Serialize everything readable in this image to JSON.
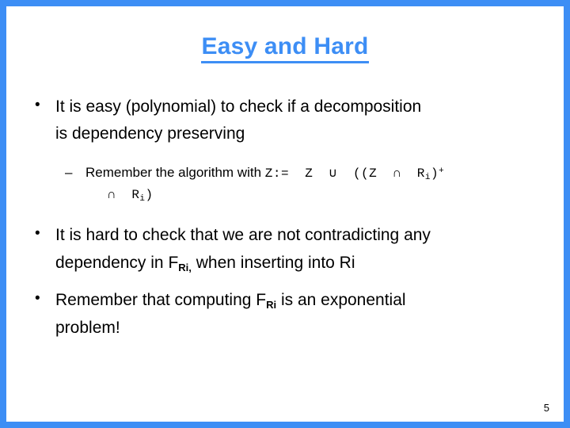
{
  "slide": {
    "title": "Easy and Hard",
    "page_number": "5",
    "accent_color": "#3d8ef5",
    "text_color": "#000000",
    "background_color": "#ffffff"
  },
  "content": {
    "bullet1": {
      "marker": "•",
      "line1": "It is easy (polynomial) to check if a decomposition",
      "line2": "is dependency preserving"
    },
    "subbullet1": {
      "marker": "–",
      "text_prefix": "Remember the algorithm with ",
      "formula_line1_a": "Z:=",
      "formula_line1_b": "Z",
      "formula_union": "∪",
      "formula_line1_c": "((Z",
      "formula_intersect": "∩",
      "formula_line1_r": "R",
      "formula_line1_sub": "i",
      "formula_line1_close": ")",
      "formula_line1_sup": "+",
      "formula_line2_intersect": "∩",
      "formula_line2_r": "R",
      "formula_line2_sub": "i",
      "formula_line2_close": ")"
    },
    "bullet2": {
      "marker": "•",
      "line1": "It is hard to check that we are not contradicting any",
      "line2_a": "dependency in F",
      "line2_sub": "Ri,",
      "line2_b": " when inserting into Ri"
    },
    "bullet3": {
      "marker": "•",
      "line1_a": "Remember that computing F",
      "line1_sub": "Ri",
      "line1_b": " is an exponential",
      "line2": "problem!"
    }
  }
}
